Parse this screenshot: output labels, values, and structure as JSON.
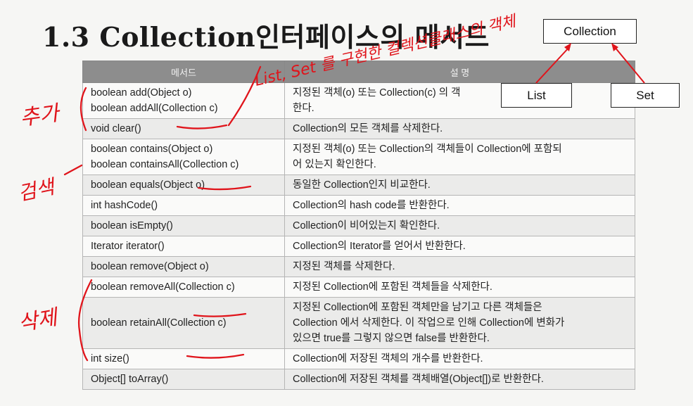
{
  "title": "1.3 Collection인터페이스의 메서드",
  "diagram": {
    "root": "Collection",
    "children": [
      "List",
      "Set"
    ]
  },
  "table": {
    "headers": [
      "메서드",
      "설 명"
    ],
    "rows": [
      {
        "method": [
          "boolean add(Object o)",
          "boolean addAll(Collection c)"
        ],
        "desc": [
          "지정된 객체(o) 또는 Collection(c) 의 객",
          "한다."
        ]
      },
      {
        "method": [
          "void clear()"
        ],
        "desc": [
          "Collection의 모든 객체를 삭제한다."
        ]
      },
      {
        "method": [
          "boolean contains(Object o)",
          "boolean containsAll(Collection c)"
        ],
        "desc": [
          "지정된 객체(o) 또는 Collection의 객체들이 Collection에 포함되",
          "어 있는지 확인한다."
        ]
      },
      {
        "method": [
          "boolean equals(Object o)"
        ],
        "desc": [
          "동일한 Collection인지 비교한다."
        ]
      },
      {
        "method": [
          "int hashCode()"
        ],
        "desc": [
          "Collection의 hash code를 반환한다."
        ]
      },
      {
        "method": [
          "boolean isEmpty()"
        ],
        "desc": [
          "Collection이 비어있는지 확인한다."
        ]
      },
      {
        "method": [
          "Iterator iterator()"
        ],
        "desc": [
          "Collection의 Iterator를 얻어서 반환한다."
        ]
      },
      {
        "method": [
          "boolean remove(Object o)"
        ],
        "desc": [
          "지정된 객체를 삭제한다."
        ]
      },
      {
        "method": [
          "boolean removeAll(Collection c)"
        ],
        "desc": [
          "지정된 Collection에 포함된 객체들을 삭제한다."
        ]
      },
      {
        "method": [
          "boolean retainAll(Collection c)"
        ],
        "desc": [
          "지정된 Collection에 포함된 객체만을 남기고 다른 객체들은",
          "Collection 에서 삭제한다. 이 작업으로 인해 Collection에 변화가",
          "있으면 true를 그렇지 않으면 false를 반환한다."
        ]
      },
      {
        "method": [
          "int size()"
        ],
        "desc": [
          "Collection에 저장된 객체의 개수를 반환한다."
        ]
      },
      {
        "method": [
          "Object[] toArray()"
        ],
        "desc": [
          "Collection에 저장된 객체를 객체배열(Object[])로 반환한다."
        ]
      }
    ]
  },
  "annotations": {
    "add_note": "추가",
    "search_note": "검색",
    "delete_note": "삭제",
    "top_note": "List, Set 를 구현한 컬렉션클래스의 객체"
  }
}
